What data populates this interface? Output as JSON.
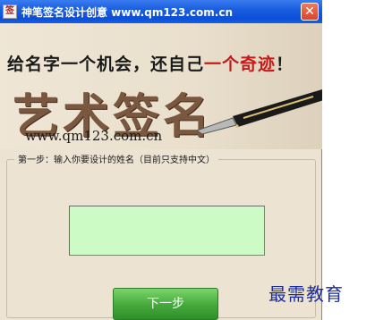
{
  "window": {
    "title": "神笔签名设计创意 www.qm123.com.cn",
    "app_icon_glyph": "签",
    "close_glyph": "✕"
  },
  "banner": {
    "tagline_prefix": "给名字一个机会，还自己",
    "tagline_accent": "一个奇迹",
    "tagline_suffix": "！",
    "big_text": "艺术签名",
    "url": "www.qm123.com.cn"
  },
  "step": {
    "legend": "第一步：输入你要设计的姓名（目前只支持中文）",
    "name_value": "",
    "next_label": "下一步"
  },
  "watermark": "最需教育",
  "colors": {
    "titlebar": "#0c4fd6",
    "window_bg": "#ece3d3",
    "input_bg": "#ccfbc6",
    "button_green": "#44a83a",
    "accent_red": "#c41a1a",
    "watermark_blue": "#1a2d9a"
  }
}
